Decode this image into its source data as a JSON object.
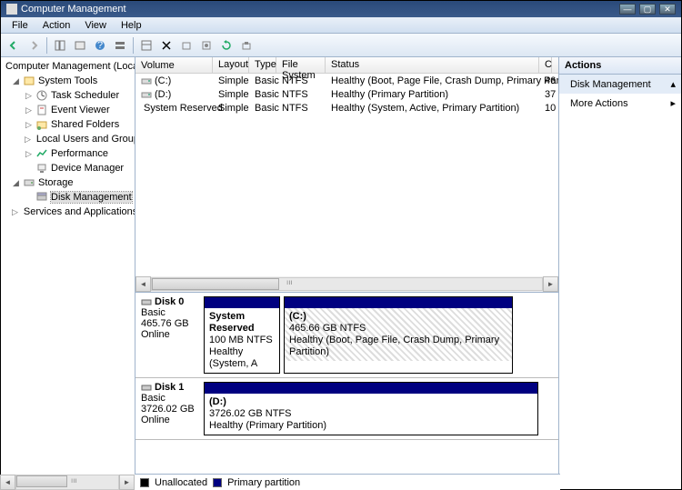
{
  "window": {
    "title": "Computer Management"
  },
  "menu": [
    "File",
    "Action",
    "View",
    "Help"
  ],
  "tree": {
    "root": "Computer Management (Local",
    "systools": "System Tools",
    "sched": "Task Scheduler",
    "evt": "Event Viewer",
    "shf": "Shared Folders",
    "lug": "Local Users and Groups",
    "perf": "Performance",
    "devm": "Device Manager",
    "storage": "Storage",
    "diskmgmt": "Disk Management",
    "svc": "Services and Applications"
  },
  "vcols": {
    "vol": "Volume",
    "lay": "Layout",
    "typ": "Type",
    "fs": "File System",
    "st": "Status",
    "cap": "C"
  },
  "vols": [
    {
      "name": "(C:)",
      "lay": "Simple",
      "typ": "Basic",
      "fs": "NTFS",
      "st": "Healthy (Boot, Page File, Crash Dump, Primary Partition)",
      "cap": "46"
    },
    {
      "name": "(D:)",
      "lay": "Simple",
      "typ": "Basic",
      "fs": "NTFS",
      "st": "Healthy (Primary Partition)",
      "cap": "37"
    },
    {
      "name": "System Reserved",
      "lay": "Simple",
      "typ": "Basic",
      "fs": "NTFS",
      "st": "Healthy (System, Active, Primary Partition)",
      "cap": "10"
    }
  ],
  "d0": {
    "name": "Disk 0",
    "type": "Basic",
    "size": "465.76 GB",
    "state": "Online",
    "p0": {
      "name": "System Reserved",
      "sz": "100 MB NTFS",
      "st": "Healthy (System, A"
    },
    "p1": {
      "name": "(C:)",
      "sz": "465.66 GB NTFS",
      "st": "Healthy (Boot, Page File, Crash Dump, Primary Partition)"
    }
  },
  "d1": {
    "name": "Disk 1",
    "type": "Basic",
    "size": "3726.02 GB",
    "state": "Online",
    "p0": {
      "name": "(D:)",
      "sz": "3726.02 GB NTFS",
      "st": "Healthy (Primary Partition)"
    }
  },
  "legend": {
    "un": "Unallocated",
    "pp": "Primary partition"
  },
  "actions": {
    "title": "Actions",
    "dm": "Disk Management",
    "more": "More Actions"
  }
}
